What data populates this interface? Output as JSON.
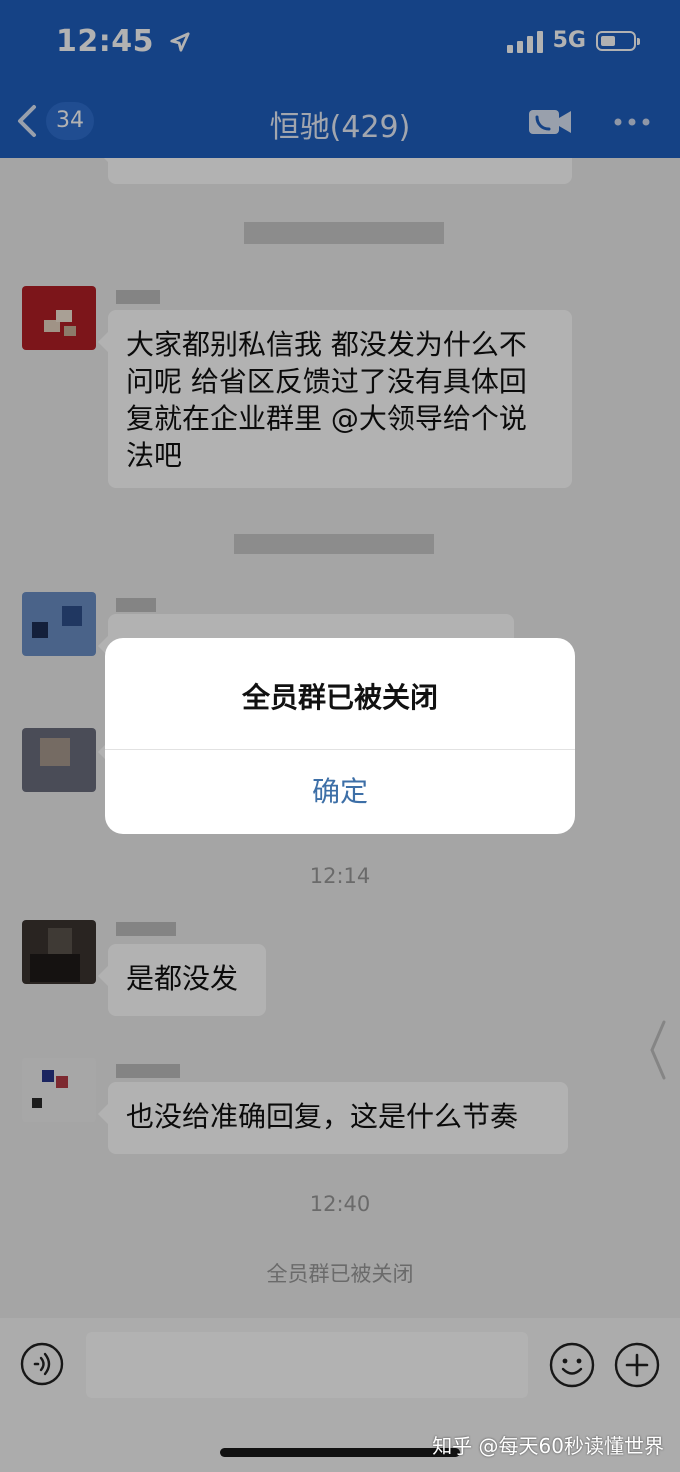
{
  "status_bar": {
    "time": "12:45",
    "network": "5G"
  },
  "header": {
    "unread_count": "34",
    "title": "恒驰(429)"
  },
  "messages": [
    {
      "text": "大家都别私信我 都没发为什么不问呢 给省区反馈过了没有具体回复就在企业群里 @大领导给个说法吧"
    },
    {
      "text": "是都没发"
    },
    {
      "text": "也没给准确回复，这是什么节奏"
    }
  ],
  "timestamps": [
    "12:14",
    "12:40"
  ],
  "system_notice": "全员群已被关闭",
  "dialog": {
    "title": "全员群已被关闭",
    "confirm_label": "确定"
  },
  "watermark": "知乎 @每天60秒读懂世界",
  "colors": {
    "header_bg": "#1f5fbf",
    "dialog_button": "#3d6fa7",
    "chat_bg": "#ededed"
  },
  "icons": [
    "back-chevron-icon",
    "video-call-icon",
    "more-icon",
    "voice-icon",
    "emoji-icon",
    "plus-icon",
    "location-arrow-icon",
    "signal-icon",
    "battery-icon"
  ]
}
